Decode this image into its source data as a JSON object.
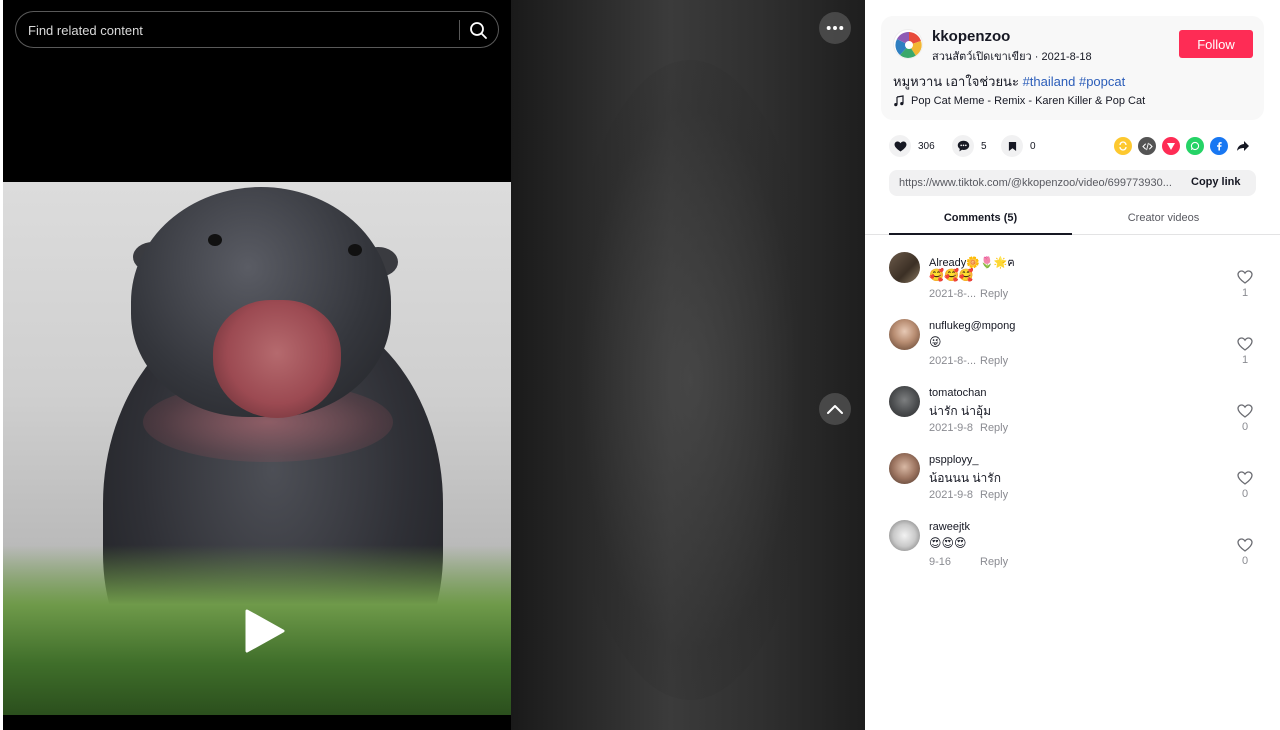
{
  "search": {
    "placeholder": "Find related content"
  },
  "author": {
    "username": "kkopenzoo",
    "display_name": "สวนสัตว์เปิดเขาเขียว",
    "date": "2021-8-18",
    "follow_label": "Follow"
  },
  "post": {
    "caption": "หมูหวาน เอาใจช่วยนะ",
    "hashtags": [
      "#thailand",
      "#popcat"
    ],
    "music": "Pop Cat Meme - Remix - Karen Killer & Pop Cat"
  },
  "stats": {
    "likes": "306",
    "comments": "5",
    "saves": "0"
  },
  "share": {
    "icons": [
      "repost-icon",
      "embed-icon",
      "send-to-friends-icon",
      "whatsapp-icon",
      "facebook-icon",
      "share-arrow-icon"
    ]
  },
  "link": {
    "url": "https://www.tiktok.com/@kkopenzoo/video/699773930...",
    "copy_label": "Copy link"
  },
  "tabs": [
    {
      "label": "Comments (5)",
      "active": true
    },
    {
      "label": "Creator videos",
      "active": false
    }
  ],
  "comments": [
    {
      "user": "Already🌼🌷🌟ฅ",
      "text": "🥰🥰🥰",
      "date": "2021-8-...",
      "reply": "Reply",
      "likes": "1"
    },
    {
      "user": "nuflukeg@mpong",
      "text": "😜",
      "date": "2021-8-...",
      "reply": "Reply",
      "likes": "1"
    },
    {
      "user": "tomatochan",
      "text": "น่ารัก น่าอุ้ม",
      "date": "2021-9-8",
      "reply": "Reply",
      "likes": "0"
    },
    {
      "user": "pspployy_",
      "text": "น้อนนน น่ารัก",
      "date": "2021-9-8",
      "reply": "Reply",
      "likes": "0"
    },
    {
      "user": "raweejtk",
      "text": "😍😍😍",
      "date": "9-16",
      "reply": "Reply",
      "likes": "0"
    }
  ],
  "colors": {
    "accent": "#fe2c55",
    "hashtag": "#2b5db9"
  }
}
